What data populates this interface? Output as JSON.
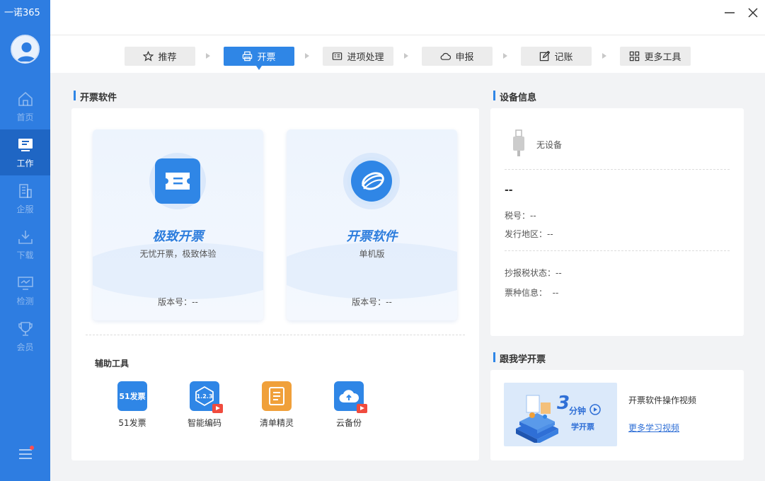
{
  "app": {
    "brand": "一诺365"
  },
  "sidebar": {
    "items": [
      {
        "label": "首页",
        "icon": "home-icon"
      },
      {
        "label": "工作",
        "icon": "monitor-icon",
        "active": true
      },
      {
        "label": "企服",
        "icon": "building-icon"
      },
      {
        "label": "下载",
        "icon": "download-icon"
      },
      {
        "label": "检测",
        "icon": "screen-check-icon"
      },
      {
        "label": "会员",
        "icon": "trophy-icon"
      }
    ]
  },
  "tabs": [
    {
      "label": "推荐",
      "icon": "star-icon"
    },
    {
      "label": "开票",
      "icon": "printer-icon",
      "active": true
    },
    {
      "label": "进项处理",
      "icon": "invoice-icon"
    },
    {
      "label": "申报",
      "icon": "cloud-icon"
    },
    {
      "label": "记账",
      "icon": "edit-icon"
    },
    {
      "label": "更多工具",
      "icon": "grid-icon"
    }
  ],
  "invoice_software": {
    "title": "开票软件",
    "cards": [
      {
        "name": "极致开票",
        "subtitle": "无忧开票，极致体验",
        "version": "版本号：--"
      },
      {
        "name": "开票软件",
        "subtitle": "单机版",
        "version": "版本号：--"
      }
    ],
    "tools_title": "辅助工具",
    "tools": [
      {
        "label": "51发票",
        "icon_text": "51发票",
        "color": "#2f86e6"
      },
      {
        "label": "智能编码",
        "icon_text": "1.2.3",
        "color": "#2f86e6",
        "video": true
      },
      {
        "label": "清单精灵",
        "icon_text": "",
        "color": "#f0a03a"
      },
      {
        "label": "云备份",
        "icon_text": "",
        "color": "#2f86e6",
        "video": true
      }
    ]
  },
  "device": {
    "title": "设备信息",
    "status": "无设备",
    "name": "--",
    "tax_no": "税号：--",
    "region": "发行地区：--",
    "report_status": "抄报税状态：--",
    "ticket_info": "票种信息：  --"
  },
  "learn": {
    "title": "跟我学开票",
    "banner_number": "3",
    "banner_unit": "分钟",
    "banner_caption": "学开票",
    "video_title": "开票软件操作视频",
    "more_link": "更多学习视频"
  },
  "colors": {
    "sidebar": "#2e7de1",
    "accent": "#2f86e6"
  }
}
